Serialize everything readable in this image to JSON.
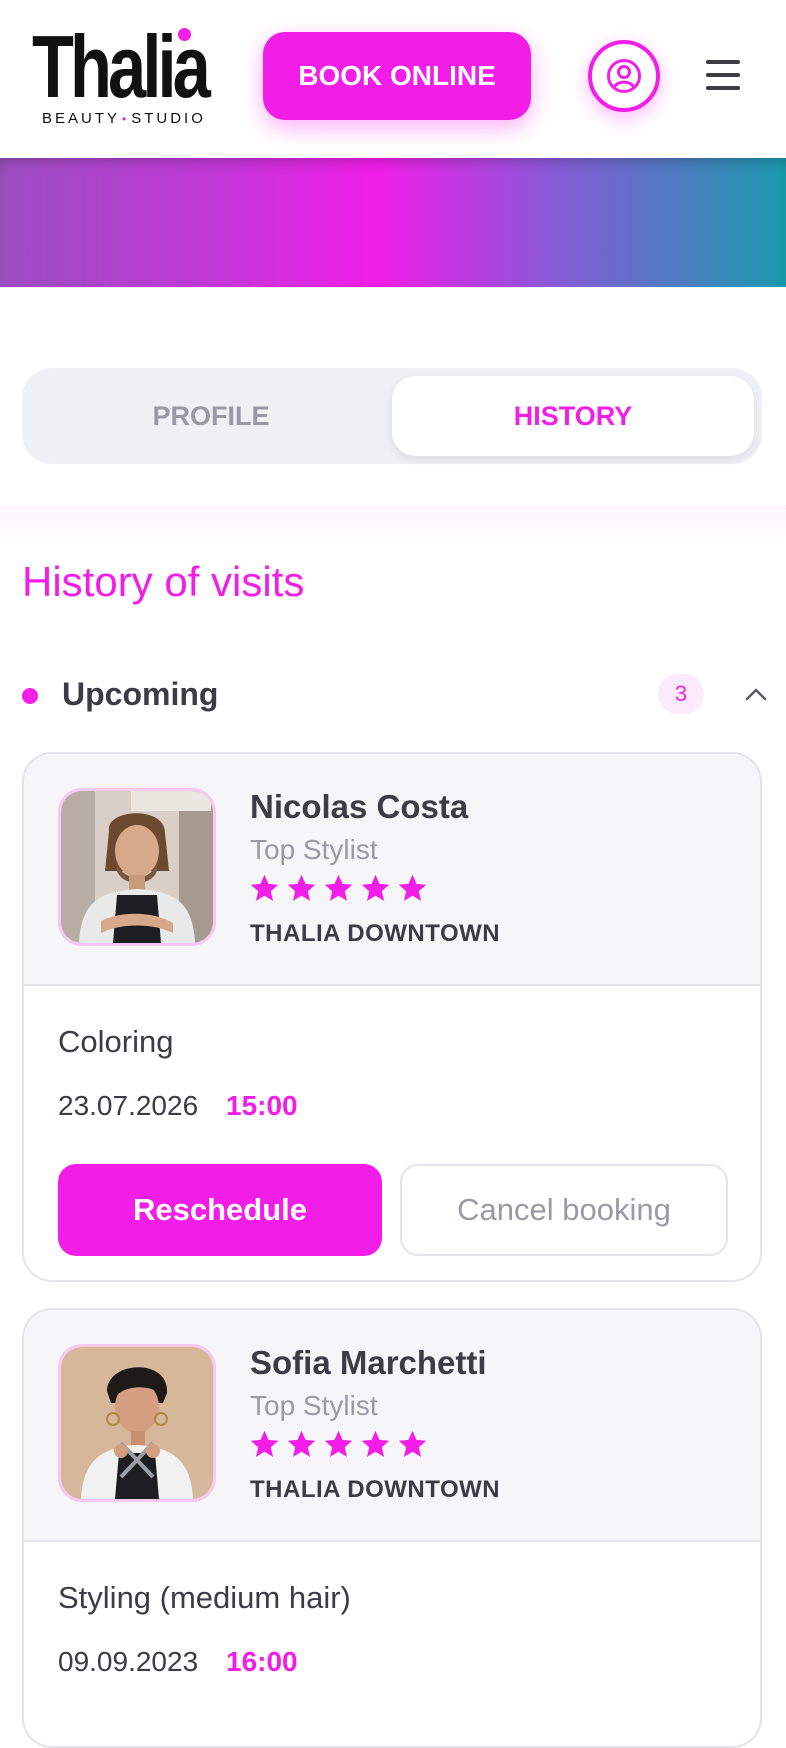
{
  "brand": {
    "name": "Thalia",
    "tagline_left": "BEAUTY",
    "tagline_sep": "•",
    "tagline_right": "STUDIO",
    "accent": "#f21ee8"
  },
  "header": {
    "book_label": "BOOK ONLINE",
    "user_icon": "user-circle-icon",
    "menu_icon": "hamburger-menu-icon"
  },
  "tabs": [
    {
      "label": "PROFILE",
      "active": false
    },
    {
      "label": "HISTORY",
      "active": true
    }
  ],
  "section": {
    "title": "History of visits"
  },
  "group": {
    "label": "Upcoming",
    "count": "3",
    "expanded": true
  },
  "visits": [
    {
      "stylist": "Nicolas Costa",
      "role": "Top Stylist",
      "rating": 5,
      "salon": "THALIA DOWNTOWN",
      "service": "Coloring",
      "date": "23.07.2026",
      "time": "15:00",
      "reschedule_label": "Reschedule",
      "cancel_label": "Cancel booking"
    },
    {
      "stylist": "Sofia Marchetti",
      "role": "Top Stylist",
      "rating": 5,
      "salon": "THALIA DOWNTOWN",
      "service": "Styling (medium hair)",
      "date": "09.09.2023",
      "time": "16:00"
    }
  ]
}
